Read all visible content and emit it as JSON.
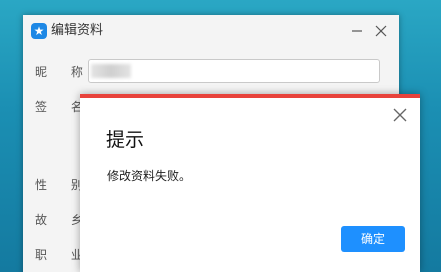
{
  "window": {
    "title": "编辑资料",
    "logo_icon": "★",
    "minimize_icon": "minimize-icon",
    "close_icon": "close-icon"
  },
  "form": {
    "labels": [
      "昵 称",
      "签 名",
      "性 别",
      "故 乡",
      "职 业"
    ],
    "nickname_value": ""
  },
  "dialog": {
    "title": "提示",
    "message": "修改资料失败。",
    "ok_label": "确定",
    "accent_color": "#e8423b",
    "button_color": "#1e90ff"
  }
}
